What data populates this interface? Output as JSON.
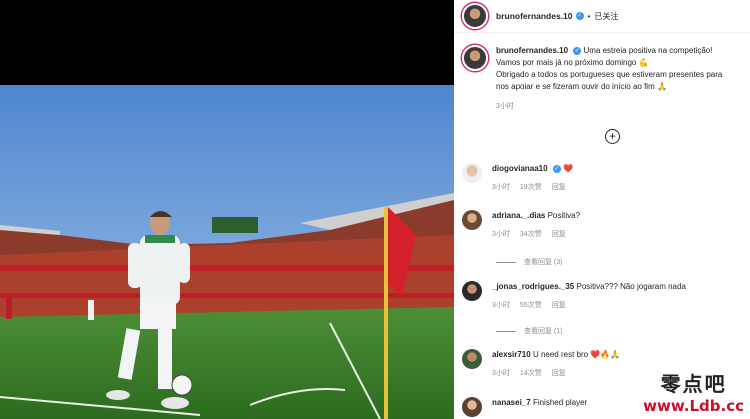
{
  "post": {
    "username": "brunofernandes.10",
    "follow_state": "已关注",
    "caption_lines": [
      "Uma estreia positiva na competição!",
      "Vamos por mais já no próximo domingo 💪",
      "Obrigado a todos os portugueses que estiveram presentes para",
      "nos apoiar e se fizeram ouvir do início ao fim 🙏"
    ],
    "time": "3小时"
  },
  "comments": [
    {
      "user": "diogovianaa10",
      "verified": true,
      "text": "❤️",
      "time": "3小时",
      "likes": "19次赞",
      "reply": "回复",
      "view_replies": ""
    },
    {
      "user": "adriana._.dias",
      "verified": false,
      "text": "Positiva?",
      "time": "3小时",
      "likes": "34次赞",
      "reply": "回复",
      "view_replies": "查看回复 (3)"
    },
    {
      "user": "_jonas_rodrigues._35",
      "verified": false,
      "text": "Positiva??? Não jogaram nada",
      "time": "3小时",
      "likes": "55次赞",
      "reply": "回复",
      "view_replies": "查看回复 (1)"
    },
    {
      "user": "alexsir710",
      "verified": false,
      "text": "U need rest bro ❤️🔥🙏",
      "time": "3小时",
      "likes": "14次赞",
      "reply": "回复",
      "view_replies": ""
    },
    {
      "user": "nanasei_7",
      "verified": false,
      "text": "Finished player",
      "time": "",
      "likes": "",
      "reply": "",
      "view_replies": ""
    }
  ],
  "watermark": {
    "cn": "零点吧",
    "url": "www.Ldb.cc"
  },
  "colors": {
    "verified": "#3897f0",
    "pitch": "#3f8a2e",
    "sky": "#5f96d8",
    "flag": "#d4202a"
  }
}
